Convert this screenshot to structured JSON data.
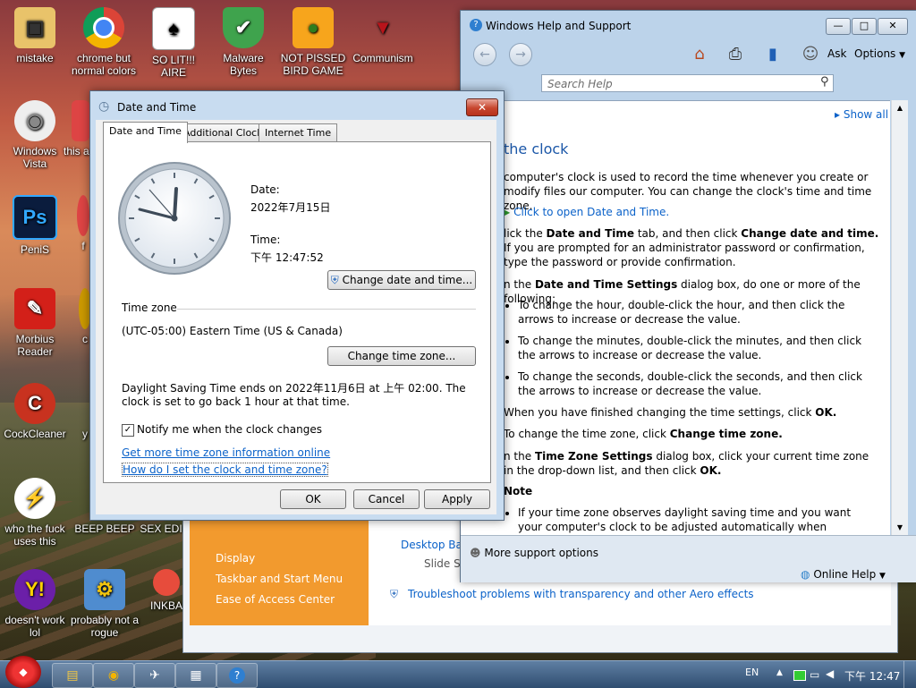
{
  "desktop": {
    "icons": [
      {
        "label": "mistake"
      },
      {
        "label": "chrome but normal colors"
      },
      {
        "label": "SO LIT!!! AIRE"
      },
      {
        "label": "Malware Bytes"
      },
      {
        "label": "NOT PISSED BIRD GAME"
      },
      {
        "label": "Communism"
      },
      {
        "label": "Windows Vista"
      },
      {
        "label": "this a v"
      },
      {
        "label": "PeniS"
      },
      {
        "label": "f"
      },
      {
        "label": "Morbius Reader"
      },
      {
        "label": "c"
      },
      {
        "label": "CockCleaner"
      },
      {
        "label": "y"
      },
      {
        "label": "who the fuck uses this"
      },
      {
        "label": "BEEP BEEP"
      },
      {
        "label": "SEX EDI"
      },
      {
        "label": "doesn't work lol"
      },
      {
        "label": "probably not a rogue"
      },
      {
        "label": "INKBA"
      }
    ]
  },
  "help": {
    "title": "Windows Help and Support",
    "ask": "Ask",
    "options": "Options",
    "search_placeholder": "Search Help",
    "show_all": "Show all",
    "heading": "the clock",
    "intro": "computer's clock is used to record the time whenever you create or modify files our computer. You can change the clock's time and time zone.",
    "open_link": "Click to open Date and Time.",
    "step1a": "lick the ",
    "step1b": "Date and Time",
    "step1c": " tab, and then click ",
    "step1d": "Change date and time.",
    "step1e": " If you are prompted for an administrator password or confirmation, type the password or provide confirmation.",
    "step2a": "n the ",
    "step2b": "Date and Time Settings",
    "step2c": " dialog box, do one or more of the following:",
    "bullet1": "To change the hour, double-click the hour, and then click the arrows to increase or decrease the value.",
    "bullet2": "To change the minutes, double-click the minutes, and then click the arrows to increase or decrease the value.",
    "bullet3": "To change the seconds, double-click the seconds, and then click the arrows to increase or decrease the value.",
    "step3a": "When you have finished changing the time settings, click ",
    "step3b": "OK.",
    "step4a": "To change the time zone, click ",
    "step4b": "Change time zone.",
    "step5a": "n the ",
    "step5b": "Time Zone Settings",
    "step5c": " dialog box, click your current time zone in the drop-down list, and then click ",
    "step5d": "OK.",
    "note": "Note",
    "note_bullet": "If your time zone observes daylight saving time and you want your computer's clock to be adjusted automatically when daylight saving",
    "more_support": "More support options",
    "online_help": "Online Help"
  },
  "cpanel": {
    "items": [
      "Display",
      "Taskbar and Start Menu",
      "Ease of Access Center"
    ],
    "desktop_back": "Desktop Back",
    "slide_show": "Slide Sh",
    "troubleshoot": "Troubleshoot problems with transparency and other Aero effects"
  },
  "dialog": {
    "title": "Date and Time",
    "tabs": [
      "Date and Time",
      "Additional Clocks",
      "Internet Time"
    ],
    "date_label": "Date:",
    "date_value": "2022年7月15日",
    "time_label": "Time:",
    "time_value": "下午 12:47:52",
    "change_date_btn": "Change date and time...",
    "timezone_heading": "Time zone",
    "timezone_value": "(UTC-05:00) Eastern Time (US & Canada)",
    "change_tz_btn": "Change time zone...",
    "dst_text": "Daylight Saving Time ends on 2022年11月6日 at 上午 02:00. The clock is set to go back 1 hour at that time.",
    "notify_label": "Notify me when the clock changes",
    "link1": "Get more time zone information online",
    "link2": "How do I set the clock and time zone?",
    "ok": "OK",
    "cancel": "Cancel",
    "apply": "Apply"
  },
  "taskbar": {
    "lang": "EN",
    "clock": "下午 12:47"
  }
}
